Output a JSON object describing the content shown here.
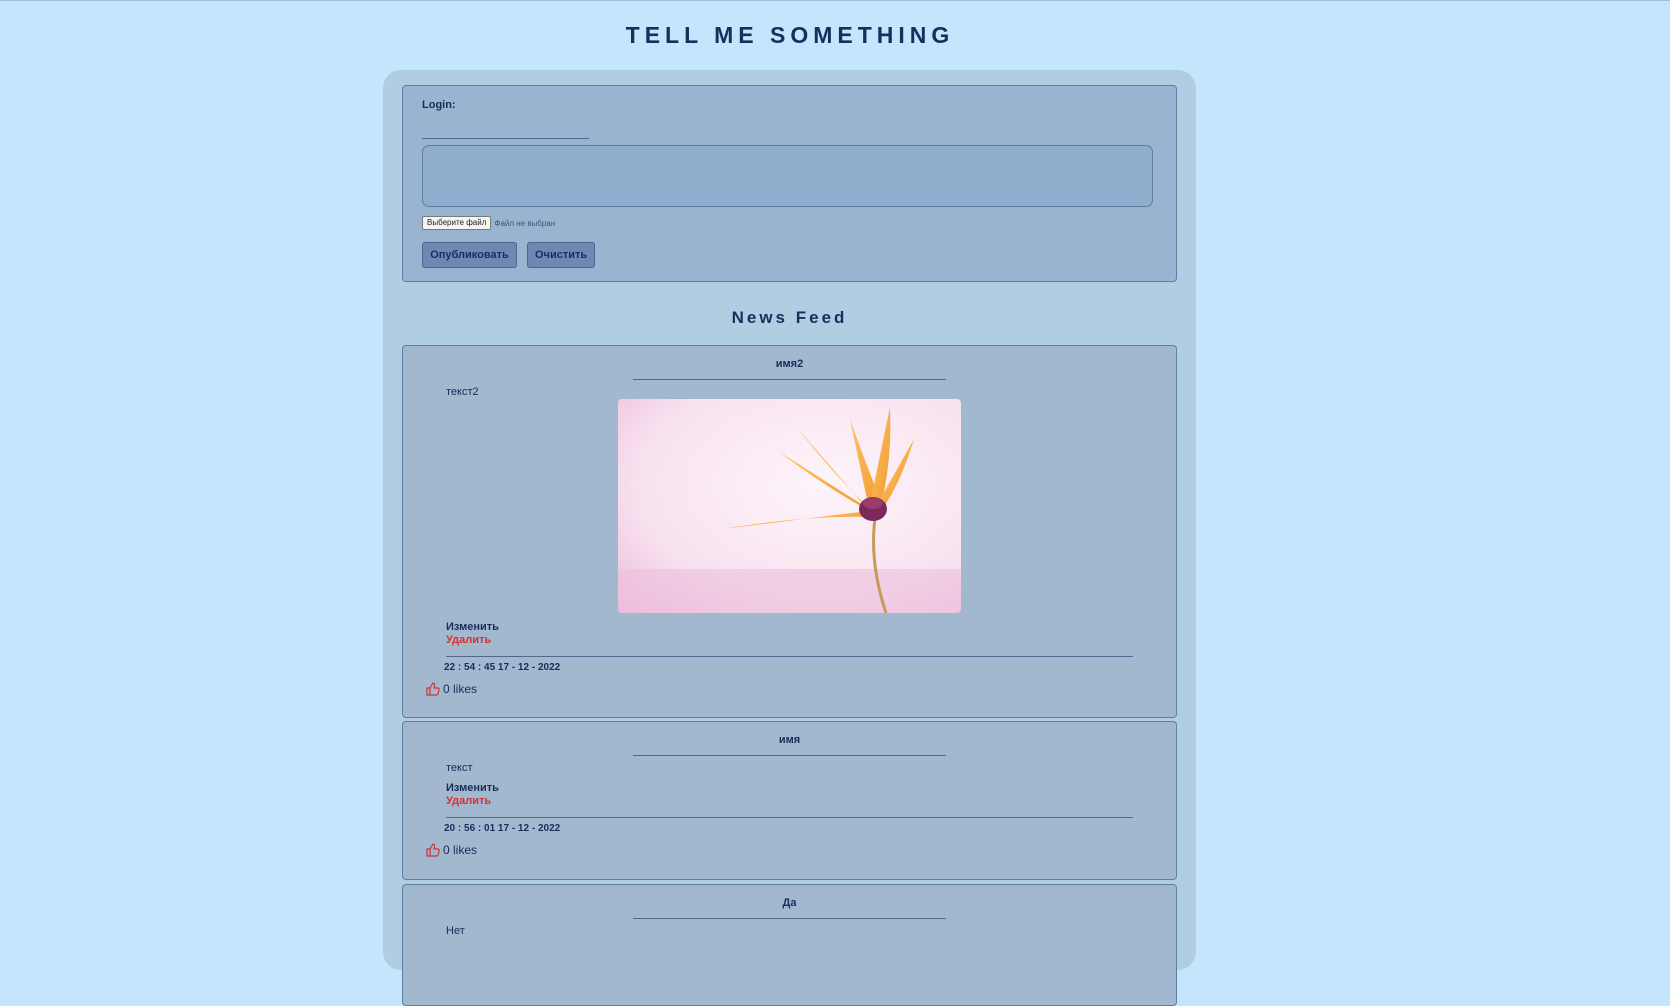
{
  "site": {
    "title": "TELL ME SOMETHING"
  },
  "compose": {
    "login_label": "Login:",
    "login_value": "",
    "text_value": "",
    "file_button": "Выберите файл",
    "file_status": "Файл не выбран",
    "publish_label": "Опубликовать",
    "clear_label": "Очистить"
  },
  "feed": {
    "title": "News Feed",
    "posts": [
      {
        "author": "имя2",
        "text": "текст2",
        "has_image": true,
        "image_desc": "flower-photo",
        "edit_label": "Изменить",
        "delete_label": "Удалить",
        "date": "22 : 54 : 45 17 - 12 - 2022",
        "likes": "0 likes"
      },
      {
        "author": "имя",
        "text": "текст",
        "has_image": false,
        "edit_label": "Изменить",
        "delete_label": "Удалить",
        "date": "20 : 56 : 01 17 - 12 - 2022",
        "likes": "0 likes"
      },
      {
        "author": "Да",
        "text": "Нет",
        "has_image": false
      }
    ]
  },
  "colors": {
    "page_bg": "#c3e6fc",
    "panel_bg": "#b1cde2",
    "card_bg": "#a2b8ce",
    "accent_text": "#13305e",
    "delete_red": "#d8302e",
    "like_icon": "#d8302e"
  },
  "icons": {
    "like": "thumbs-up-icon"
  }
}
